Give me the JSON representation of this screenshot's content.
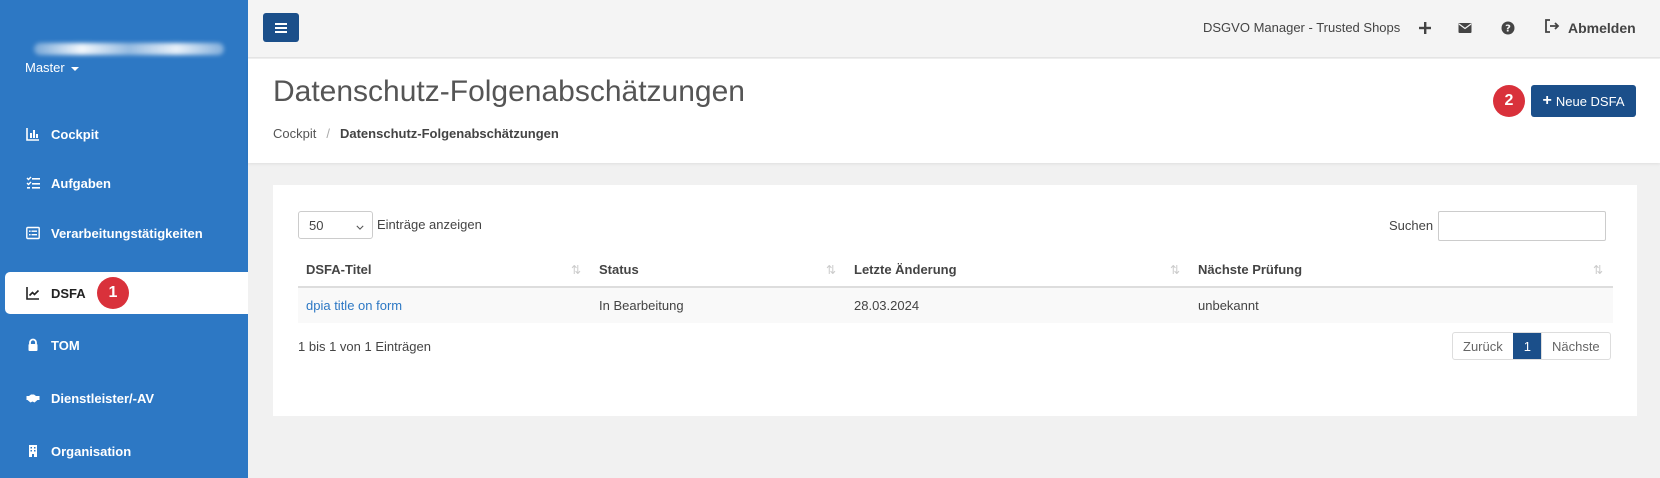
{
  "sidebar": {
    "org_label": "Master",
    "items": [
      {
        "label": "Cockpit",
        "icon": "chart-bar-icon"
      },
      {
        "label": "Aufgaben",
        "icon": "tasks-icon"
      },
      {
        "label": "Verarbeitungstätigkeiten",
        "icon": "list-alt-icon"
      },
      {
        "label": "DSFA",
        "icon": "chart-line-icon"
      },
      {
        "label": "TOM",
        "icon": "lock-icon"
      },
      {
        "label": "Dienstleister/-AV",
        "icon": "handshake-icon"
      },
      {
        "label": "Organisation",
        "icon": "building-icon"
      }
    ],
    "active": "DSFA"
  },
  "annotations": {
    "badge1": "1",
    "badge2": "2",
    "color": "#d9313b"
  },
  "topbar": {
    "app_title": "DSGVO Manager - Trusted Shops",
    "logout_label": "Abmelden"
  },
  "header": {
    "title": "Datenschutz-Folgenabschätzungen",
    "breadcrumb": [
      "Cockpit",
      "Datenschutz-Folgenabschätzungen"
    ],
    "new_button_label": "Neue DSFA"
  },
  "table": {
    "length_value": "50",
    "length_label": "Einträge anzeigen",
    "search_label": "Suchen",
    "columns": [
      "DSFA-Titel",
      "Status",
      "Letzte Änderung",
      "Nächste Prüfung"
    ],
    "rows": [
      [
        "dpia title on form",
        "In Bearbeitung",
        "28.03.2024",
        "unbekannt"
      ]
    ],
    "info": "1 bis 1 von 1 Einträgen",
    "pagination": {
      "prev": "Zurück",
      "current": "1",
      "next": "Nächste"
    }
  },
  "colors": {
    "sidebar": "#2d78c4",
    "primary": "#1b4f8a",
    "link": "#2d78c4"
  }
}
